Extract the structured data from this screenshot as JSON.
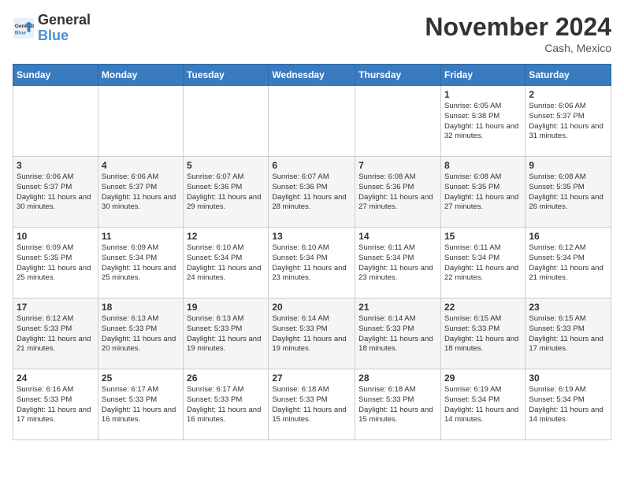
{
  "logo": {
    "text_general": "General",
    "text_blue": "Blue"
  },
  "header": {
    "month": "November 2024",
    "location": "Cash, Mexico"
  },
  "weekdays": [
    "Sunday",
    "Monday",
    "Tuesday",
    "Wednesday",
    "Thursday",
    "Friday",
    "Saturday"
  ],
  "weeks": [
    [
      {
        "day": "",
        "info": ""
      },
      {
        "day": "",
        "info": ""
      },
      {
        "day": "",
        "info": ""
      },
      {
        "day": "",
        "info": ""
      },
      {
        "day": "",
        "info": ""
      },
      {
        "day": "1",
        "info": "Sunrise: 6:05 AM\nSunset: 5:38 PM\nDaylight: 11 hours and 32 minutes."
      },
      {
        "day": "2",
        "info": "Sunrise: 6:06 AM\nSunset: 5:37 PM\nDaylight: 11 hours and 31 minutes."
      }
    ],
    [
      {
        "day": "3",
        "info": "Sunrise: 6:06 AM\nSunset: 5:37 PM\nDaylight: 11 hours and 30 minutes."
      },
      {
        "day": "4",
        "info": "Sunrise: 6:06 AM\nSunset: 5:37 PM\nDaylight: 11 hours and 30 minutes."
      },
      {
        "day": "5",
        "info": "Sunrise: 6:07 AM\nSunset: 5:36 PM\nDaylight: 11 hours and 29 minutes."
      },
      {
        "day": "6",
        "info": "Sunrise: 6:07 AM\nSunset: 5:36 PM\nDaylight: 11 hours and 28 minutes."
      },
      {
        "day": "7",
        "info": "Sunrise: 6:08 AM\nSunset: 5:36 PM\nDaylight: 11 hours and 27 minutes."
      },
      {
        "day": "8",
        "info": "Sunrise: 6:08 AM\nSunset: 5:35 PM\nDaylight: 11 hours and 27 minutes."
      },
      {
        "day": "9",
        "info": "Sunrise: 6:08 AM\nSunset: 5:35 PM\nDaylight: 11 hours and 26 minutes."
      }
    ],
    [
      {
        "day": "10",
        "info": "Sunrise: 6:09 AM\nSunset: 5:35 PM\nDaylight: 11 hours and 25 minutes."
      },
      {
        "day": "11",
        "info": "Sunrise: 6:09 AM\nSunset: 5:34 PM\nDaylight: 11 hours and 25 minutes."
      },
      {
        "day": "12",
        "info": "Sunrise: 6:10 AM\nSunset: 5:34 PM\nDaylight: 11 hours and 24 minutes."
      },
      {
        "day": "13",
        "info": "Sunrise: 6:10 AM\nSunset: 5:34 PM\nDaylight: 11 hours and 23 minutes."
      },
      {
        "day": "14",
        "info": "Sunrise: 6:11 AM\nSunset: 5:34 PM\nDaylight: 11 hours and 23 minutes."
      },
      {
        "day": "15",
        "info": "Sunrise: 6:11 AM\nSunset: 5:34 PM\nDaylight: 11 hours and 22 minutes."
      },
      {
        "day": "16",
        "info": "Sunrise: 6:12 AM\nSunset: 5:34 PM\nDaylight: 11 hours and 21 minutes."
      }
    ],
    [
      {
        "day": "17",
        "info": "Sunrise: 6:12 AM\nSunset: 5:33 PM\nDaylight: 11 hours and 21 minutes."
      },
      {
        "day": "18",
        "info": "Sunrise: 6:13 AM\nSunset: 5:33 PM\nDaylight: 11 hours and 20 minutes."
      },
      {
        "day": "19",
        "info": "Sunrise: 6:13 AM\nSunset: 5:33 PM\nDaylight: 11 hours and 19 minutes."
      },
      {
        "day": "20",
        "info": "Sunrise: 6:14 AM\nSunset: 5:33 PM\nDaylight: 11 hours and 19 minutes."
      },
      {
        "day": "21",
        "info": "Sunrise: 6:14 AM\nSunset: 5:33 PM\nDaylight: 11 hours and 18 minutes."
      },
      {
        "day": "22",
        "info": "Sunrise: 6:15 AM\nSunset: 5:33 PM\nDaylight: 11 hours and 18 minutes."
      },
      {
        "day": "23",
        "info": "Sunrise: 6:15 AM\nSunset: 5:33 PM\nDaylight: 11 hours and 17 minutes."
      }
    ],
    [
      {
        "day": "24",
        "info": "Sunrise: 6:16 AM\nSunset: 5:33 PM\nDaylight: 11 hours and 17 minutes."
      },
      {
        "day": "25",
        "info": "Sunrise: 6:17 AM\nSunset: 5:33 PM\nDaylight: 11 hours and 16 minutes."
      },
      {
        "day": "26",
        "info": "Sunrise: 6:17 AM\nSunset: 5:33 PM\nDaylight: 11 hours and 16 minutes."
      },
      {
        "day": "27",
        "info": "Sunrise: 6:18 AM\nSunset: 5:33 PM\nDaylight: 11 hours and 15 minutes."
      },
      {
        "day": "28",
        "info": "Sunrise: 6:18 AM\nSunset: 5:33 PM\nDaylight: 11 hours and 15 minutes."
      },
      {
        "day": "29",
        "info": "Sunrise: 6:19 AM\nSunset: 5:34 PM\nDaylight: 11 hours and 14 minutes."
      },
      {
        "day": "30",
        "info": "Sunrise: 6:19 AM\nSunset: 5:34 PM\nDaylight: 11 hours and 14 minutes."
      }
    ]
  ]
}
